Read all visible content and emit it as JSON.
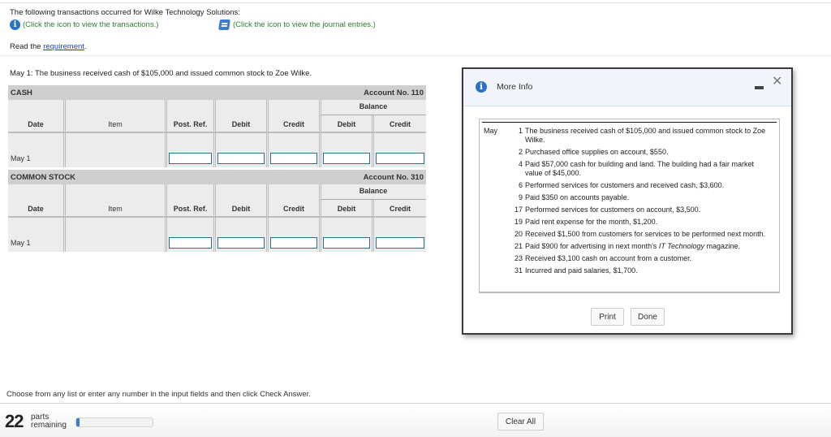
{
  "intro": "The following transactions occurred for Wilke Technology Solutions:",
  "links": {
    "transactions": "(Click the icon to view the transactions.)",
    "journal": "(Click the icon to view the journal entries.)"
  },
  "requirement": {
    "prefix": "Read the ",
    "link": "requirement",
    "suffix": "."
  },
  "question": "May 1: The business received cash of $105,000 and issued common stock to Zoe Wilke.",
  "ledgers": [
    {
      "account": "CASH",
      "account_no": "Account No. 110",
      "balance_label": "Balance",
      "columns": [
        "Date",
        "Item",
        "Post. Ref.",
        "Debit",
        "Credit",
        "Debit",
        "Credit"
      ],
      "rows": [
        {
          "date": "May 1",
          "post_ref": "",
          "debit": "",
          "credit": "",
          "bal_debit": "",
          "bal_credit": ""
        }
      ]
    },
    {
      "account": "COMMON STOCK",
      "account_no": "Account No. 310",
      "balance_label": "Balance",
      "columns": [
        "Date",
        "Item",
        "Post. Ref.",
        "Debit",
        "Credit",
        "Debit",
        "Credit"
      ],
      "rows": [
        {
          "date": "May 1",
          "post_ref": "",
          "debit": "",
          "credit": "",
          "bal_debit": "",
          "bal_credit": ""
        }
      ]
    }
  ],
  "instructions": "Choose from any list or enter any number in the input fields and then click Check Answer.",
  "parts": {
    "count": "22",
    "label_line1": "parts",
    "label_line2": "remaining",
    "progress_fraction": 0.04
  },
  "buttons": {
    "clear_all": "Clear All"
  },
  "modal": {
    "title": "More Info",
    "month": "May",
    "transactions": [
      {
        "day": "1",
        "text": "The business received cash of $105,000 and issued common stock to Zoe Wilke."
      },
      {
        "day": "2",
        "text": "Purchased office supplies on account, $550."
      },
      {
        "day": "4",
        "text": "Paid $57,000 cash for building and land. The building had a fair market value of $45,000."
      },
      {
        "day": "6",
        "text": "Performed services for customers and received cash, $3,600."
      },
      {
        "day": "9",
        "text": "Paid $350 on accounts payable."
      },
      {
        "day": "17",
        "text": "Performed services for customers on account, $3,500."
      },
      {
        "day": "19",
        "text": "Paid rent expense for the month, $1,200."
      },
      {
        "day": "20",
        "text": "Received $1,500 from customers for services to be performed next month."
      },
      {
        "day": "21",
        "text_before": "Paid $900 for advertising in next month's ",
        "text_italic": "IT Technology",
        "text_after": " magazine."
      },
      {
        "day": "23",
        "text": "Received $3,100 cash on account from a customer."
      },
      {
        "day": "31",
        "text": "Incurred and paid salaries, $1,700."
      }
    ],
    "print_label": "Print",
    "done_label": "Done"
  },
  "colors": {
    "accent": "#2a72c9",
    "link_green": "#2e7d32",
    "link_blue": "#1a3fd4",
    "progress": "#3a7bd5"
  }
}
